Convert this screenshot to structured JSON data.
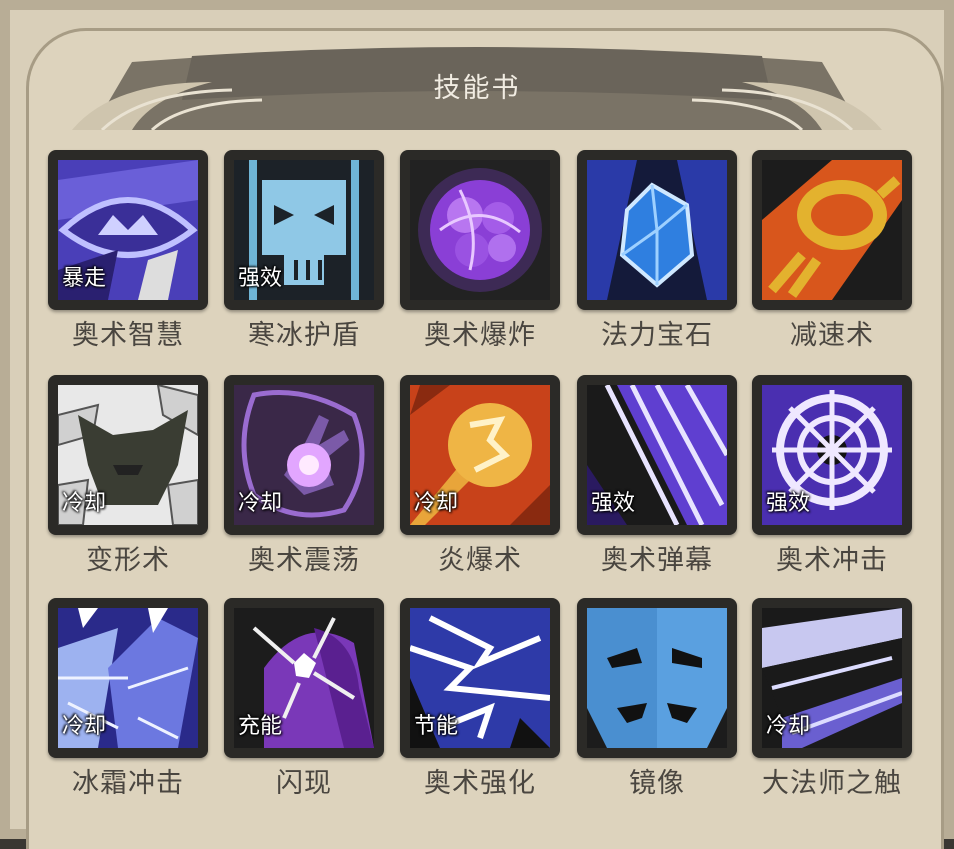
{
  "title": "技能书",
  "skills": [
    {
      "name": "奥术智慧",
      "tag": "暴走",
      "icon": "arcane-eye-icon"
    },
    {
      "name": "寒冰护盾",
      "tag": "强效",
      "icon": "ice-skull-icon"
    },
    {
      "name": "奥术爆炸",
      "tag": "",
      "icon": "arcane-orb-icon"
    },
    {
      "name": "法力宝石",
      "tag": "",
      "icon": "mana-gem-icon"
    },
    {
      "name": "减速术",
      "tag": "",
      "icon": "chain-ring-icon"
    },
    {
      "name": "变形术",
      "tag": "冷却",
      "icon": "sheep-head-icon"
    },
    {
      "name": "奥术震荡",
      "tag": "冷却",
      "icon": "arcane-hand-icon"
    },
    {
      "name": "炎爆术",
      "tag": "冷却",
      "icon": "fireball-icon"
    },
    {
      "name": "奥术弹幕",
      "tag": "强效",
      "icon": "arcane-barrage-icon"
    },
    {
      "name": "奥术冲击",
      "tag": "强效",
      "icon": "arcane-wheel-icon"
    },
    {
      "name": "冰霜冲击",
      "tag": "冷却",
      "icon": "frost-shards-icon"
    },
    {
      "name": "闪现",
      "tag": "充能",
      "icon": "blink-icon"
    },
    {
      "name": "奥术强化",
      "tag": "节能",
      "icon": "lightning-icon"
    },
    {
      "name": "镜像",
      "tag": "",
      "icon": "mirror-faces-icon"
    },
    {
      "name": "大法师之触",
      "tag": "冷却",
      "icon": "archmage-claw-icon"
    }
  ]
}
